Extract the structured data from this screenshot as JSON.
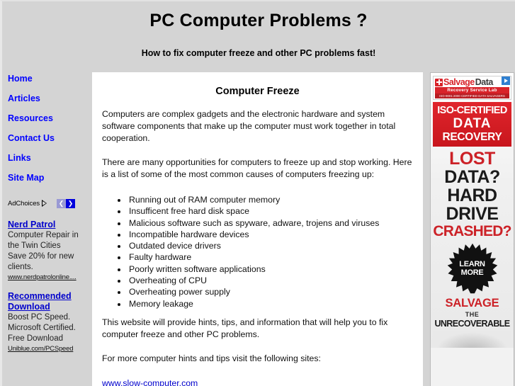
{
  "header": {
    "title": "PC Computer Problems ?",
    "subtitle": "How to fix computer freeze and other PC problems fast!"
  },
  "sidebar": {
    "nav": [
      {
        "label": "Home"
      },
      {
        "label": "Articles"
      },
      {
        "label": "Resources"
      },
      {
        "label": "Contact Us"
      },
      {
        "label": "Links"
      },
      {
        "label": "Site Map"
      }
    ],
    "adchoices": {
      "label": "AdChoices",
      "prev_arrow": "❮",
      "next_arrow": "❯"
    },
    "ads": [
      {
        "title": "Nerd Patrol",
        "lines": [
          "Computer Repair in",
          "the Twin Cities",
          "Save 20% for new",
          "clients."
        ],
        "url": "www.nerdpatrolonline...."
      },
      {
        "title_line1": "Recommended",
        "title_line2": "Download",
        "lines": [
          "Boost PC Speed.",
          "Microsoft Certified.",
          "Free Download"
        ],
        "url": "Uniblue.com/PCSpeed"
      }
    ]
  },
  "main": {
    "title": "Computer Freeze",
    "paragraph1": "Computers are complex gadgets and the electronic hardware and system software components that make up the computer must work together in total cooperation.",
    "paragraph2": "There are many opportunities for computers to freeze up and stop working. Here is a list of some of the most common causes of computers freezing up:",
    "causes": [
      "Running out of RAM computer memory",
      "Insufficent free hard disk space",
      "Malicious software such as spyware, adware, trojens and viruses",
      "Incompatible hardware devices",
      "Outdated device drivers",
      "Faulty hardware",
      "Poorly written software applications",
      "Overheating of CPU",
      "Overheating power supply",
      "Memory leakage"
    ],
    "paragraph3": "This website will provide hints, tips, and information that will help you to fix computer freeze and other PC problems.",
    "paragraph4": "For more computer hints and tips visit the following sites:",
    "link": "www.slow-computer.com"
  },
  "banner_ad": {
    "logo_brand_a": "Salvage",
    "logo_brand_b": "Data",
    "logo_subtitle": "Recovery Service Lab",
    "logo_iso": "ISO-9001:2000 CERTIFIED DATA SALVAGERS",
    "red_line1": "ISO-CERTIFIED",
    "red_line2": "DATA",
    "red_line3": "RECOVERY",
    "headline1": "LOST",
    "headline2": "DATA?",
    "headline3": "HARD",
    "headline4": "DRIVE",
    "headline5": "CRASHED?",
    "badge_line1": "LEARN",
    "badge_line2": "MORE",
    "tagline1": "SALVAGE",
    "tagline2": "THE",
    "tagline3": "UNRECOVERABLE"
  },
  "colors": {
    "page_background": "#d4d4d4",
    "content_background": "#ffffff",
    "nav_link": "#0000ff",
    "ad_link": "#0000cc",
    "brand_red": "#d8232a",
    "banner_red_panel": "#cc2127"
  }
}
